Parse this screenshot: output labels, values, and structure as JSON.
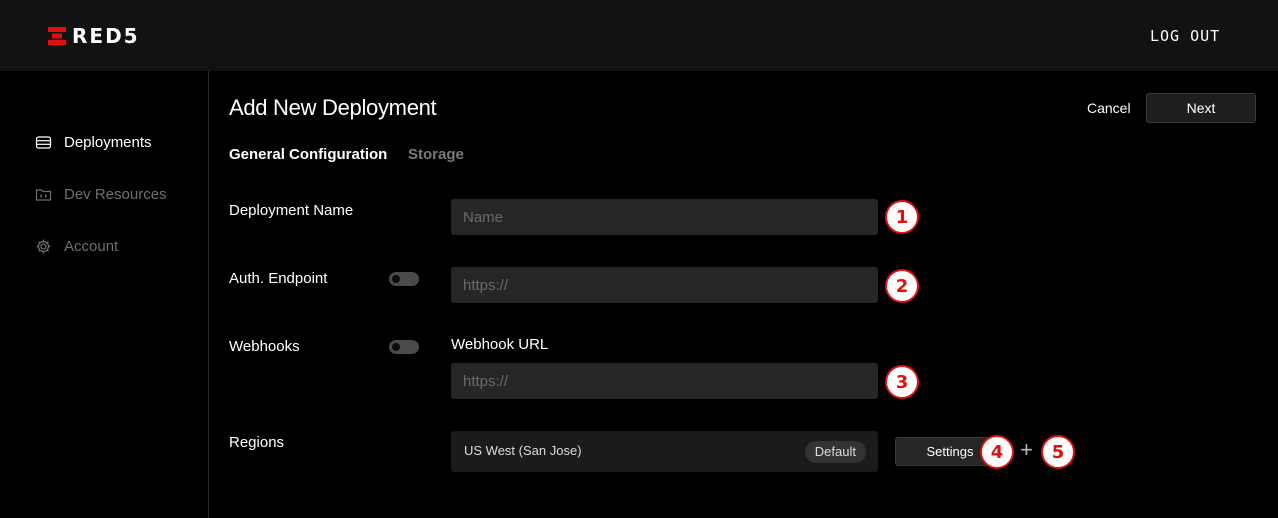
{
  "header": {
    "brand": "RED5",
    "logout_label": "LOG OUT"
  },
  "sidebar": {
    "items": [
      {
        "label": "Deployments",
        "icon": "database-icon",
        "active": true
      },
      {
        "label": "Dev Resources",
        "icon": "code-folder-icon",
        "active": false
      },
      {
        "label": "Account",
        "icon": "gear-icon",
        "active": false
      }
    ]
  },
  "page": {
    "title": "Add New Deployment",
    "cancel_label": "Cancel",
    "next_label": "Next",
    "tabs": [
      {
        "label": "General Configuration"
      },
      {
        "label": "Storage"
      }
    ]
  },
  "form": {
    "deployment_name": {
      "label": "Deployment Name",
      "placeholder": "Name",
      "value": ""
    },
    "auth_endpoint": {
      "label": "Auth. Endpoint",
      "placeholder": "https://",
      "value": "",
      "enabled": false
    },
    "webhooks": {
      "label": "Webhooks",
      "enabled": false,
      "url_label": "Webhook URL",
      "placeholder": "https://",
      "value": ""
    },
    "regions": {
      "label": "Regions",
      "items": [
        {
          "name": "US West (San Jose)",
          "badge": "Default"
        }
      ],
      "settings_label": "Settings",
      "add_label": "+"
    }
  },
  "callouts": [
    "1",
    "2",
    "3",
    "4",
    "5"
  ],
  "colors": {
    "accent": "#e10f0f",
    "background": "#000000",
    "topbar": "#121212",
    "input": "#262626"
  }
}
